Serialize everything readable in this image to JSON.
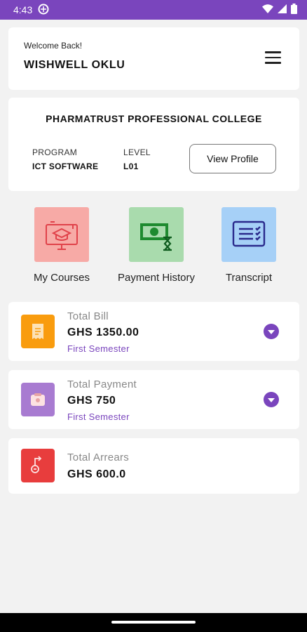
{
  "status_bar": {
    "time": "4:43"
  },
  "header": {
    "welcome": "Welcome Back!",
    "user_name": "WISHWELL OKLU"
  },
  "college": {
    "name": "PHARMATRUST PROFESSIONAL COLLEGE",
    "program_label": "PROGRAM",
    "program_value": "ICT SOFTWARE",
    "level_label": "LEVEL",
    "level_value": "L01",
    "view_profile": "View Profile"
  },
  "quick_links": [
    {
      "label": "My Courses",
      "icon": "graduation-monitor-icon",
      "bg": "#f7aaa6"
    },
    {
      "label": "Payment History",
      "icon": "money-hourglass-icon",
      "bg": "#a9dbad"
    },
    {
      "label": "Transcript",
      "icon": "document-checklist-icon",
      "bg": "#a6d0f7"
    }
  ],
  "summary": {
    "bill": {
      "title": "Total Bill",
      "amount": "GHS 1350.00",
      "sub": "First Semester",
      "icon": "receipt-icon",
      "color": "#f99c0e"
    },
    "payment": {
      "title": "Total Payment",
      "amount": "GHS 750",
      "sub": "First Semester",
      "icon": "wallet-icon",
      "color": "#a87bd1"
    },
    "arrears": {
      "title": "Total Arrears",
      "amount": "GHS 600.0",
      "icon": "arrears-icon",
      "color": "#e83d3d"
    }
  },
  "colors": {
    "accent": "#7a45bd",
    "background": "#f2f2f2"
  }
}
